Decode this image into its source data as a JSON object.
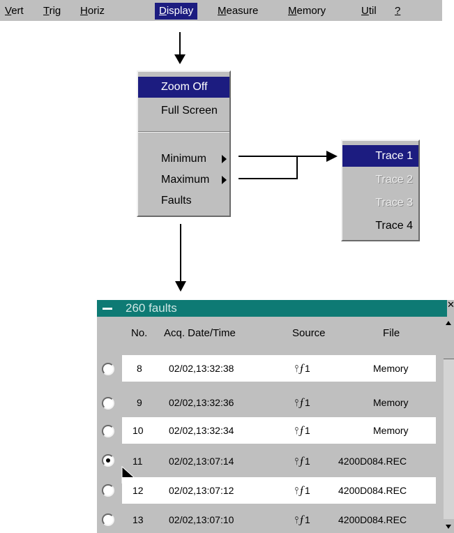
{
  "menubar": {
    "items": [
      {
        "label": "Vert",
        "accel": "V",
        "rest": "ert"
      },
      {
        "label": "Trig",
        "accel": "T",
        "rest": "rig"
      },
      {
        "label": "Horiz",
        "accel": "H",
        "rest": "oriz"
      },
      {
        "label": "Display",
        "accel": "D",
        "rest": "isplay",
        "active": true
      },
      {
        "label": "Measure",
        "accel": "M",
        "rest": "easure"
      },
      {
        "label": "Memory",
        "accel": "M",
        "rest": "emory"
      },
      {
        "label": "Util",
        "accel": "U",
        "rest": "til"
      },
      {
        "label": "?",
        "accel": "?",
        "rest": ""
      }
    ]
  },
  "display_menu": {
    "items": [
      "Zoom Off",
      "Full Screen",
      "Minimum",
      "Maximum",
      "Faults"
    ],
    "highlighted": "Zoom Off"
  },
  "trace_menu": {
    "items": [
      "Trace 1",
      "Trace 2",
      "Trace 3",
      "Trace 4"
    ],
    "highlighted": "Trace 1",
    "disabled": [
      "Trace 2",
      "Trace 3"
    ]
  },
  "faults_window": {
    "title": "260 faults",
    "headers": {
      "no": "No.",
      "datetime": "Acq. Date/Time",
      "source": "Source",
      "file": "File"
    },
    "rows": [
      {
        "no": "8",
        "datetime": "02/02,13:32:38",
        "source": "⫯⨍1",
        "file": "Memory",
        "selected": false
      },
      {
        "no": "9",
        "datetime": "02/02,13:32:36",
        "source": "⫯⨍1",
        "file": "Memory",
        "selected": false
      },
      {
        "no": "10",
        "datetime": "02/02,13:32:34",
        "source": "⫯⨍1",
        "file": "Memory",
        "selected": false
      },
      {
        "no": "11",
        "datetime": "02/02,13:07:14",
        "source": "⫯⨍1",
        "file": "4200D084.REC",
        "selected": true
      },
      {
        "no": "12",
        "datetime": "02/02,13:07:12",
        "source": "⫯⨍1",
        "file": "4200D084.REC",
        "selected": false
      },
      {
        "no": "13",
        "datetime": "02/02,13:07:10",
        "source": "⫯⨍1",
        "file": "4200D084.REC",
        "selected": false
      }
    ]
  },
  "colors": {
    "menubar": "#bfbfbf",
    "highlight": "#1c1c80",
    "titlebar": "#0e7a74"
  }
}
